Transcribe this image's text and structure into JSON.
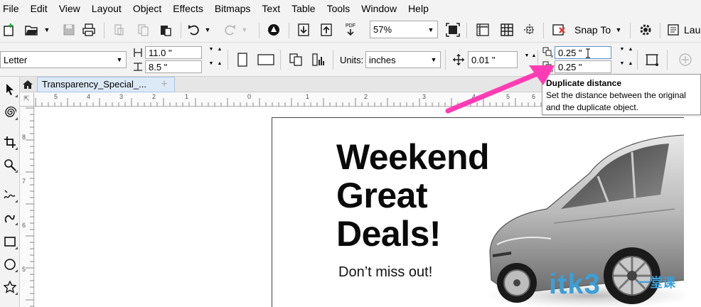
{
  "menubar": [
    "File",
    "Edit",
    "View",
    "Layout",
    "Object",
    "Effects",
    "Bitmaps",
    "Text",
    "Table",
    "Tools",
    "Window",
    "Help"
  ],
  "standard_toolbar": {
    "zoom_value": "57%",
    "snap_to_label": "Snap To",
    "pdf_label": "PDF",
    "launch_label": "Lau"
  },
  "property_bar": {
    "page_size": "Letter",
    "width": "11.0 \"",
    "height": "8.5 \"",
    "units_label": "Units:",
    "units_value": "inches",
    "nudge_distance": "0.01 \"",
    "duplicate_x": "0.25 \"",
    "duplicate_y": "0.25 \""
  },
  "document_tab": {
    "title": "Transparency_Special_..."
  },
  "ruler": {
    "h_numbers": [
      "5",
      "4",
      "3",
      "2",
      "1",
      "0",
      "1",
      "2",
      "3",
      "4",
      "5",
      "6"
    ],
    "v_numbers": [
      "8",
      "7",
      "6",
      "5"
    ]
  },
  "tooltip": {
    "title": "Duplicate distance",
    "line1": "Set the distance between the original",
    "line2": "and the duplicate object."
  },
  "artwork": {
    "headline": [
      "Weekend",
      "Great",
      "Deals!"
    ],
    "tagline": "Don’t miss out!"
  },
  "watermark": {
    "text": "itk3",
    "sub": "一堂课"
  },
  "colors": {
    "arrow": "#ff3cb4",
    "tab_active": "#dce9f7",
    "watermark": "#3a9fd8"
  }
}
